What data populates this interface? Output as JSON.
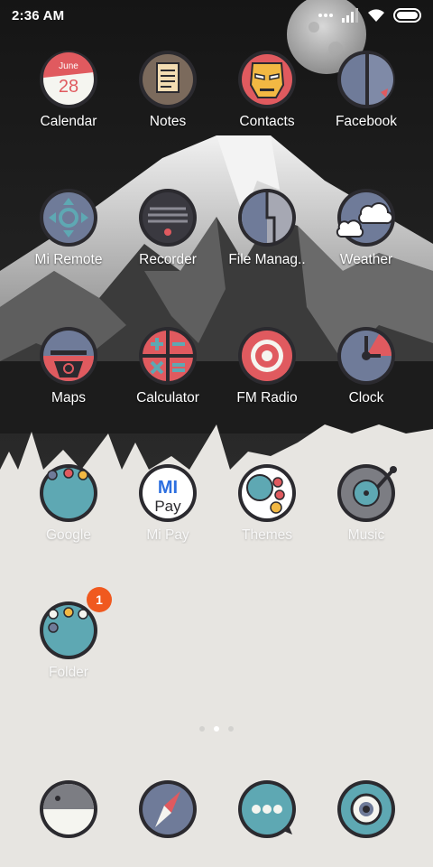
{
  "status_bar": {
    "time": "2:36 AM",
    "icons": [
      "more-dots-icon",
      "signal-icon",
      "wifi-icon",
      "battery-icon"
    ]
  },
  "calendar_icon": {
    "month": "June",
    "day": "28"
  },
  "home_rows": [
    [
      "Calendar",
      "Notes",
      "Contacts",
      "Facebook"
    ],
    [
      "Mi Remote",
      "Recorder",
      "File Manag..",
      "Weather"
    ],
    [
      "Maps",
      "Calculator",
      "FM Radio",
      "Clock"
    ],
    [
      "Google",
      "Mi Pay",
      "Themes",
      "Music"
    ],
    [
      "Folder"
    ]
  ],
  "mipay_icon": {
    "line1": "MI",
    "line2": "Pay"
  },
  "folder_badge": "1",
  "page_indicator": {
    "pages": 3,
    "current": 2
  },
  "dock": [
    "phone-icon",
    "browser-compass-icon",
    "messaging-icon",
    "camera-icon"
  ],
  "colors": {
    "icon_outline": "#2b2a2f",
    "teal": "#5ea8b3",
    "slate": "#6f7b99",
    "coral": "#e05a5f",
    "badge": "#f0591f"
  }
}
